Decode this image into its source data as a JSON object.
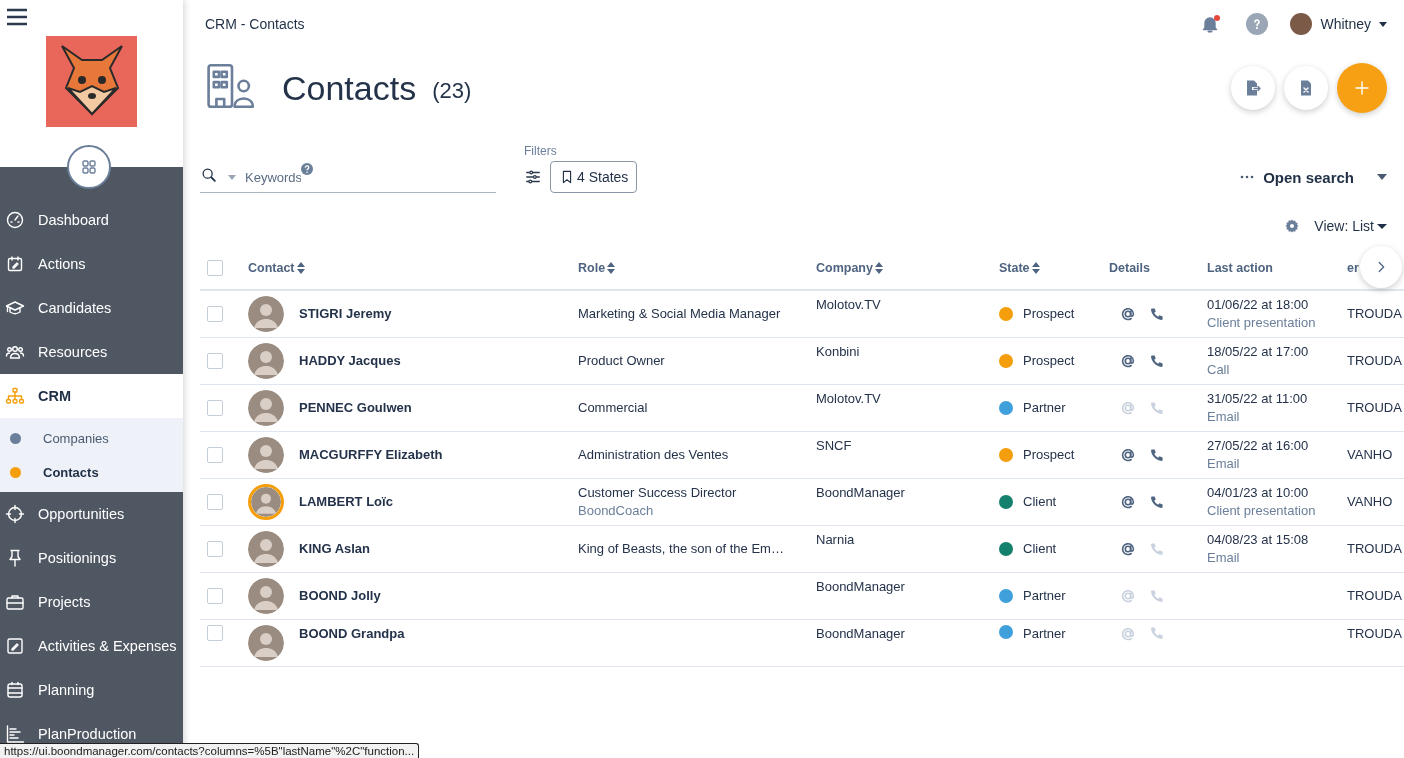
{
  "sidebar": {
    "items": [
      {
        "label": "Dashboard",
        "selected": false
      },
      {
        "label": "Actions",
        "selected": false
      },
      {
        "label": "Candidates",
        "selected": false
      },
      {
        "label": "Resources",
        "selected": false
      },
      {
        "label": "CRM",
        "selected": true,
        "expanded": true,
        "children": [
          {
            "label": "Companies",
            "selected": false,
            "color": "#6b7f9a"
          },
          {
            "label": "Contacts",
            "selected": true,
            "color": "#f59e0b"
          }
        ]
      },
      {
        "label": "Opportunities",
        "selected": false
      },
      {
        "label": "Positionings",
        "selected": false
      },
      {
        "label": "Projects",
        "selected": false
      },
      {
        "label": "Activities & Expenses",
        "selected": false
      },
      {
        "label": "Planning",
        "selected": false
      },
      {
        "label": "PlanProduction",
        "selected": false
      }
    ]
  },
  "header": {
    "breadcrumb": "CRM - Contacts",
    "notifications_unread": true,
    "user": "Whitney"
  },
  "page": {
    "title": "Contacts",
    "count": "(23)"
  },
  "search": {
    "placeholder": "Keywords",
    "filters_label": "Filters",
    "filter_chip": "4 States",
    "open_search": "Open search",
    "view": "View: List"
  },
  "table": {
    "columns": [
      "Contact",
      "Role",
      "Company",
      "State",
      "Details",
      "Last action",
      "er"
    ],
    "sortable": [
      true,
      true,
      true,
      true,
      false,
      false,
      false
    ],
    "all_checked": false,
    "rows": [
      {
        "checked": false,
        "contact": "STIGRI Jeremy",
        "ringed": false,
        "role": "Marketing & Social Media Manager",
        "company": "Molotov.TV",
        "state": "Prospect",
        "color": "#f59e0b",
        "email": true,
        "phone": true,
        "date": "01/06/22 at 18:00",
        "action": "Client presentation",
        "owner": "TROUDA"
      },
      {
        "checked": false,
        "contact": "HADDY Jacques",
        "ringed": false,
        "role": "Product Owner",
        "company": "Konbini",
        "state": "Prospect",
        "color": "#f59e0b",
        "email": true,
        "phone": true,
        "date": "18/05/22 at 17:00",
        "action": "Call",
        "owner": "TROUDA"
      },
      {
        "checked": false,
        "contact": "PENNEC Goulwen",
        "ringed": false,
        "role": "Commercial",
        "company": "Molotov.TV",
        "state": "Partner",
        "color": "#3fa0dc",
        "email": false,
        "phone": false,
        "date": "31/05/22 at 11:00",
        "action": "Email",
        "owner": "TROUDA"
      },
      {
        "checked": false,
        "contact": "MACGURFFY Elizabeth",
        "ringed": false,
        "role": "Administration des Ventes",
        "company": "SNCF",
        "state": "Prospect",
        "color": "#f59e0b",
        "email": true,
        "phone": true,
        "date": "27/05/22 at 16:00",
        "action": "Email",
        "owner": "VANHO"
      },
      {
        "checked": false,
        "contact": "LAMBERT Loïc",
        "ringed": true,
        "role": "Customer Success Director",
        "role_note": "BoondCoach",
        "company": "BoondManager",
        "state": "Client",
        "color": "#14806e",
        "email": true,
        "phone": true,
        "date": "04/01/23 at 10:00",
        "action": "Client presentation",
        "owner": "VANHO"
      },
      {
        "checked": false,
        "contact": "KING Aslan",
        "ringed": false,
        "role": "King of Beasts, the son of the Em…",
        "company": "Narnia",
        "state": "Client",
        "color": "#14806e",
        "email": true,
        "phone": false,
        "date": "04/08/23 at 15:08",
        "action": "Email",
        "owner": "TROUDA"
      },
      {
        "checked": false,
        "contact": "BOOND Jolly",
        "ringed": false,
        "company": "BoondManager",
        "state": "Partner",
        "color": "#3fa0dc",
        "email": false,
        "phone": false,
        "owner": "TROUDA"
      },
      {
        "checked": false,
        "contact": "BOOND Grandpa",
        "ringed": false,
        "company": "BoondManager",
        "state": "Partner",
        "color": "#3fa0dc",
        "email": false,
        "phone": false,
        "owner": "TROUDA"
      }
    ]
  },
  "status_url": "https://ui.boondmanager.com/contacts?columns=%5B\"lastName\"%2C\"function..."
}
